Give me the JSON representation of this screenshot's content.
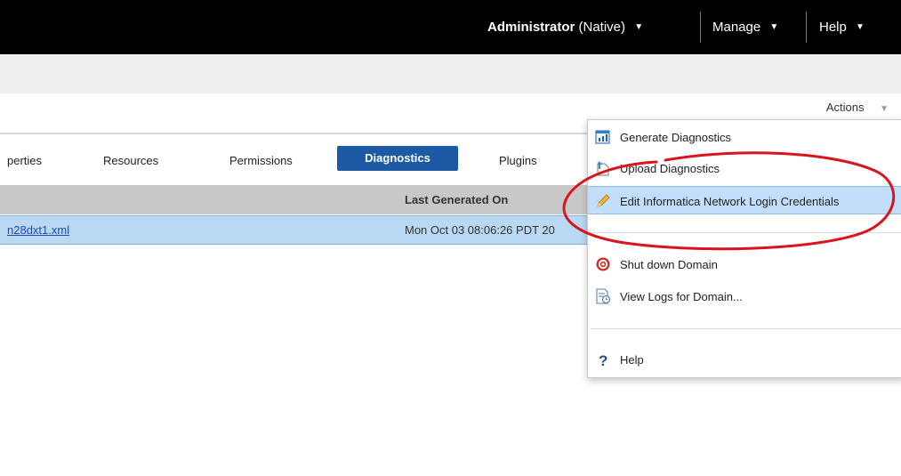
{
  "topbar": {
    "user": "Administrator",
    "user_suffix": "(Native)",
    "manage": "Manage",
    "help": "Help"
  },
  "actions": {
    "label": "Actions"
  },
  "tabs": {
    "items": [
      "perties",
      "Resources",
      "Permissions",
      "Plugins"
    ],
    "active": "Diagnostics"
  },
  "table": {
    "header_last_generated": "Last Generated On",
    "rows": [
      {
        "file": "n28dxt1.xml",
        "last_generated": "Mon Oct 03 08:06:26 PDT 20"
      }
    ]
  },
  "menu": {
    "items": [
      {
        "label": "Generate Diagnostics",
        "icon": "generate-diagnostics-icon"
      },
      {
        "label": "Upload Diagnostics",
        "icon": "upload-icon"
      },
      {
        "label": "Edit Informatica Network Login Credentials",
        "icon": "pencil-icon"
      },
      {
        "label": "Shut down Domain",
        "icon": "shutdown-icon"
      },
      {
        "label": "View Logs for Domain...",
        "icon": "view-logs-icon"
      },
      {
        "label": "Help",
        "icon": "help-icon"
      }
    ]
  },
  "colors": {
    "topbar": "#000000",
    "active_tab": "#1c5aa6",
    "selected_row": "#b8d8f3",
    "menu_highlight": "#c3defa",
    "annotation": "#d9141c"
  }
}
